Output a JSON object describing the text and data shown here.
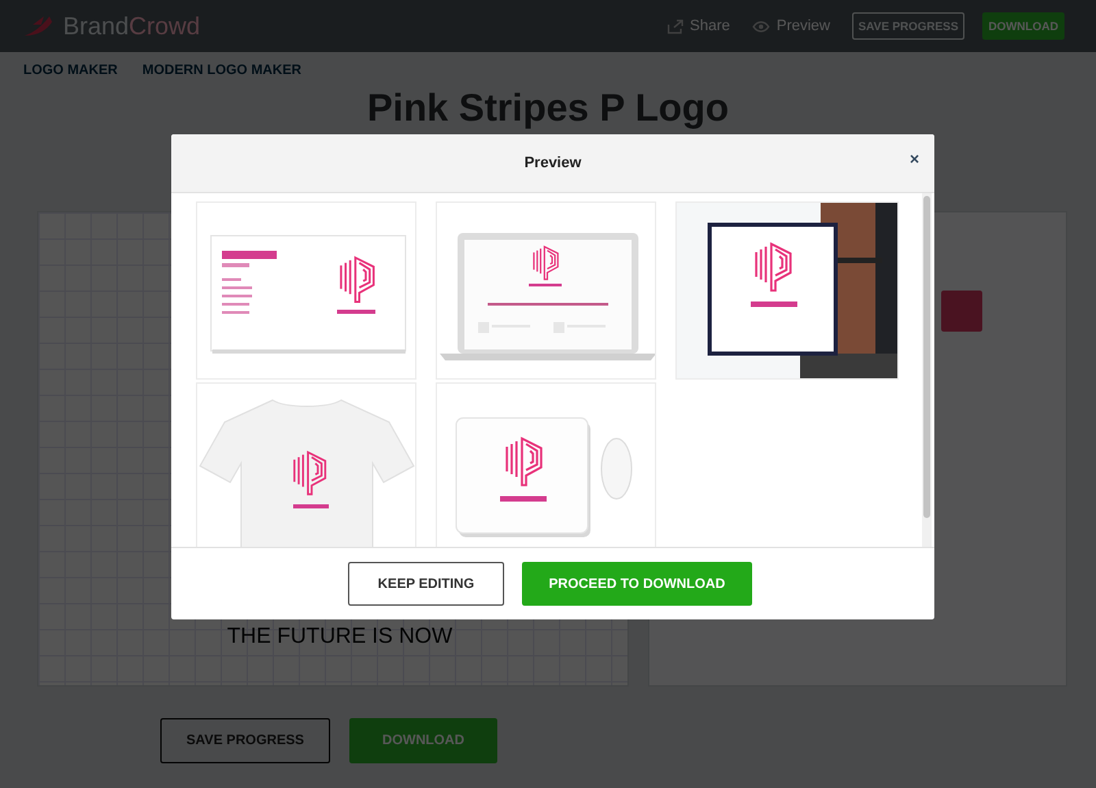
{
  "header": {
    "brand": {
      "part_1": "Brand",
      "part_2": "Crowd"
    },
    "share": "Share",
    "preview": "Preview",
    "save_button": "SAVE PROGRESS",
    "download_button": "DOWNLOAD"
  },
  "breadcrumb": [
    "LOGO MAKER",
    "MODERN LOGO MAKER"
  ],
  "title": "Pink Stripes P Logo",
  "canvas": {
    "tagline": "THE FUTURE IS NOW"
  },
  "bottom_buttons": {
    "save": "SAVE PROGRESS",
    "download": "DOWNLOAD"
  },
  "modal": {
    "title": "Preview",
    "close": "×",
    "mockups": [
      {
        "kind": "business-card"
      },
      {
        "kind": "laptop"
      },
      {
        "kind": "sign"
      },
      {
        "kind": "tshirt"
      },
      {
        "kind": "mousepad"
      }
    ],
    "keep_editing": "KEEP EDITING",
    "proceed": "PROCEED TO DOWNLOAD"
  }
}
